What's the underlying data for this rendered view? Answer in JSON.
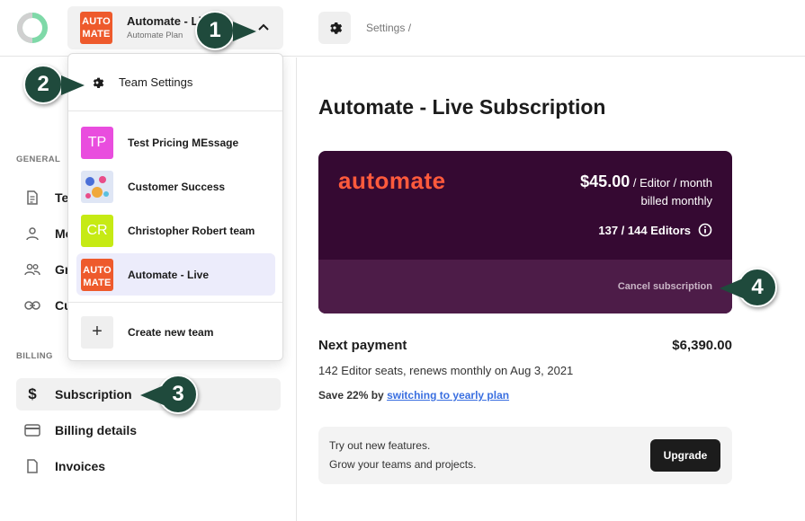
{
  "header": {
    "team_name": "Automate - Live",
    "team_plan": "Automate Plan",
    "team_logo_text": "AUTO MATE",
    "breadcrumb": "Settings /"
  },
  "dropdown": {
    "team_settings_label": "Team Settings",
    "teams": [
      {
        "initials": "TP",
        "name": "Test Pricing MEssage",
        "color": "#e94dde"
      },
      {
        "initials": "",
        "name": "Customer Success",
        "color": "#dfe6f5"
      },
      {
        "initials": "CR",
        "name": "Christopher Robert team",
        "color": "#c6ea14"
      },
      {
        "initials": "AUTO MATE",
        "name": "Automate - Live",
        "color": "#ee5a2c"
      }
    ],
    "create_label": "Create new team"
  },
  "sidebar": {
    "general_label": "GENERAL",
    "general_items": [
      {
        "label": "Te",
        "icon": "document-icon"
      },
      {
        "label": "Me",
        "icon": "person-icon"
      },
      {
        "label": "Gr",
        "icon": "group-icon"
      },
      {
        "label": "Cu",
        "icon": "link-icon"
      }
    ],
    "billing_label": "BILLING",
    "billing_items": [
      {
        "label": "Subscription",
        "icon": "dollar-icon"
      },
      {
        "label": "Billing details",
        "icon": "card-icon"
      },
      {
        "label": "Invoices",
        "icon": "file-icon"
      }
    ]
  },
  "main": {
    "title": "Automate - Live Subscription",
    "card": {
      "brand": "automate",
      "price": "$45.00",
      "price_unit": "/ Editor / month",
      "billing": "billed monthly",
      "editors": "137 / 144 Editors",
      "cancel": "Cancel subscription"
    },
    "next_payment_label": "Next payment",
    "next_payment_amount": "$6,390.00",
    "next_payment_desc": "142 Editor seats, renews monthly on Aug 3, 2021",
    "save_prefix": "Save 22% by",
    "save_link": "switching to yearly plan",
    "promo_line1": "Try out new features.",
    "promo_line2": "Grow your teams and projects.",
    "upgrade_label": "Upgrade"
  },
  "callouts": [
    "1",
    "2",
    "3",
    "4"
  ],
  "colors": {
    "accent": "#1f4a3c",
    "card_bg": "#350932",
    "brand": "#ff5a3c",
    "link": "#3a6fe0"
  }
}
